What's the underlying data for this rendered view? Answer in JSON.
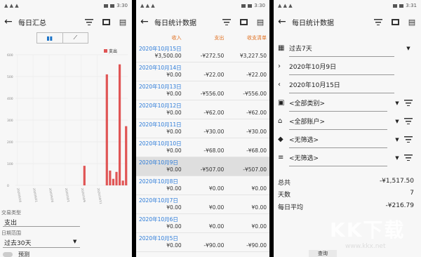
{
  "panel1": {
    "status_left": "▲ ▲ ▲",
    "status_time": "3:30",
    "title": "每日汇总",
    "legend": "支出",
    "x_ticks": [
      "2020/9/16",
      "2020/9/21",
      "2020/9/26",
      "2020/10/1",
      "2020/10/6",
      "2020/10/11"
    ],
    "y_ticks": [
      "600",
      "500",
      "400",
      "300",
      "200",
      "100",
      "0"
    ],
    "type_label": "交易类型",
    "type_value": "支出",
    "range_label": "日期范围",
    "range_value": "过去30天",
    "toggle_label": "预测"
  },
  "chart_data": {
    "type": "bar",
    "title": "",
    "series": [
      {
        "name": "支出",
        "values": [
          0,
          0,
          0,
          0,
          0,
          0,
          0,
          0,
          0,
          0,
          0,
          0,
          0,
          0,
          0,
          0,
          0,
          0,
          0,
          0,
          0,
          90,
          0,
          0,
          0,
          0,
          0,
          0,
          510,
          68,
          30,
          62,
          556,
          22,
          272
        ]
      }
    ],
    "ylim": [
      0,
      600
    ],
    "legend": "top-right"
  },
  "panel2": {
    "status_time": "3:30",
    "title": "每日统计数据",
    "col_income": "收入",
    "col_expense": "支出",
    "col_balance": "收支清单",
    "rows": [
      {
        "date": "2020年10月15日",
        "income": "¥3,500.00",
        "expense": "-¥272.50",
        "balance": "¥3,227.50"
      },
      {
        "date": "2020年10月14日",
        "income": "¥0.00",
        "expense": "-¥22.00",
        "balance": "-¥22.00"
      },
      {
        "date": "2020年10月13日",
        "income": "¥0.00",
        "expense": "-¥556.00",
        "balance": "-¥556.00"
      },
      {
        "date": "2020年10月12日",
        "income": "¥0.00",
        "expense": "-¥62.00",
        "balance": "-¥62.00"
      },
      {
        "date": "2020年10月11日",
        "income": "¥0.00",
        "expense": "-¥30.00",
        "balance": "-¥30.00"
      },
      {
        "date": "2020年10月10日",
        "income": "¥0.00",
        "expense": "-¥68.00",
        "balance": "-¥68.00"
      },
      {
        "date": "2020年10月9日",
        "income": "¥0.00",
        "expense": "-¥507.00",
        "balance": "-¥507.00"
      },
      {
        "date": "2020年10月8日",
        "income": "¥0.00",
        "expense": "¥0.00",
        "balance": "¥0.00"
      },
      {
        "date": "2020年10月7日",
        "income": "¥0.00",
        "expense": "¥0.00",
        "balance": "¥0.00"
      },
      {
        "date": "2020年10月6日",
        "income": "¥0.00",
        "expense": "¥0.00",
        "balance": "¥0.00"
      },
      {
        "date": "2020年10月5日",
        "income": "¥0.00",
        "expense": "-¥90.00",
        "balance": "-¥90.00"
      }
    ]
  },
  "panel3": {
    "status_time": "3:31",
    "title": "每日统计数据",
    "period": "过去7天",
    "date_from": "2020年10月9日",
    "date_to": "2020年10月15日",
    "category": "<全部类别>",
    "account": "<全部账户>",
    "tag": "<无筛选>",
    "status": "<无筛选>",
    "total_label": "总共",
    "total_value": "-¥1,517.50",
    "days_label": "天数",
    "days_value": "7",
    "avg_label": "每日平均",
    "avg_value": "-¥216.79",
    "bottom_button": "查询"
  },
  "watermark": "KK下载",
  "watermark_url": "www.kkx.net"
}
